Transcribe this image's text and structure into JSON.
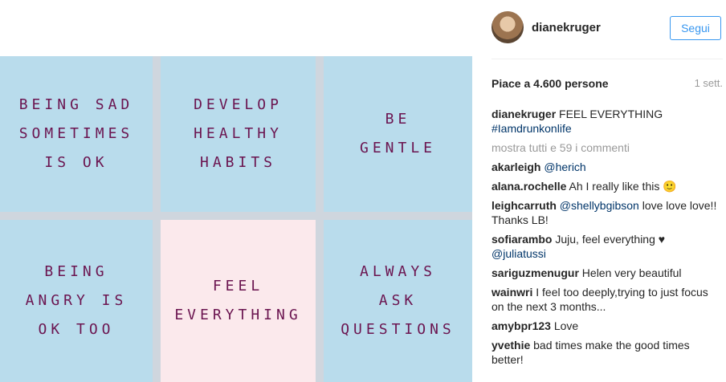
{
  "post": {
    "notes": [
      {
        "lines": [
          "BEING SAD",
          "SOMETIMES",
          "IS  OK"
        ],
        "color": "#b9dcec"
      },
      {
        "lines": [
          "DEVELOP",
          "HEALTHY",
          "HABITS"
        ],
        "color": "#b9dcec"
      },
      {
        "lines": [
          "BE",
          "GENTLE"
        ],
        "color": "#b9dcec"
      },
      {
        "lines": [
          "BEING",
          "ANGRY IS",
          "OK TOO"
        ],
        "color": "#b9dcec"
      },
      {
        "lines": [
          "FEEL",
          "EVERYTHING"
        ],
        "color": "#fbe9ec"
      },
      {
        "lines": [
          "ALWAYS",
          "ASK",
          "QUESTIONS"
        ],
        "color": "#b9dcec"
      }
    ]
  },
  "header": {
    "username": "dianekruger",
    "follow_label": "Segui"
  },
  "stats": {
    "likes": "Piace a 4.600 persone",
    "age": "1 sett."
  },
  "caption": {
    "user": "dianekruger",
    "text": "FEEL EVERYTHING",
    "hashtag": "#Iamdrunkonlife"
  },
  "show_all": "mostra tutti e 59 i commenti",
  "comments": [
    {
      "user": "akarleigh",
      "mention": "@herich",
      "text": ""
    },
    {
      "user": "alana.rochelle",
      "mention": "",
      "text": "Ah I really like this 🙂"
    },
    {
      "user": "leighcarruth",
      "mention": "@shellybgibson",
      "text": "love love love!! Thanks LB!"
    },
    {
      "user": "sofiarambo",
      "mention": "",
      "text": "Juju, feel everything ♥",
      "mention2": "@juliatussi"
    },
    {
      "user": "sariguzmenugur",
      "mention": "",
      "text": "Helen very beautiful"
    },
    {
      "user": "wainwri",
      "mention": "",
      "text": "I feel too deeply,trying to just focus on the next 3 months..."
    },
    {
      "user": "amybpr123",
      "mention": "",
      "text": "Love"
    },
    {
      "user": "yvethie",
      "mention": "",
      "text": "bad times make the good times better!"
    }
  ]
}
